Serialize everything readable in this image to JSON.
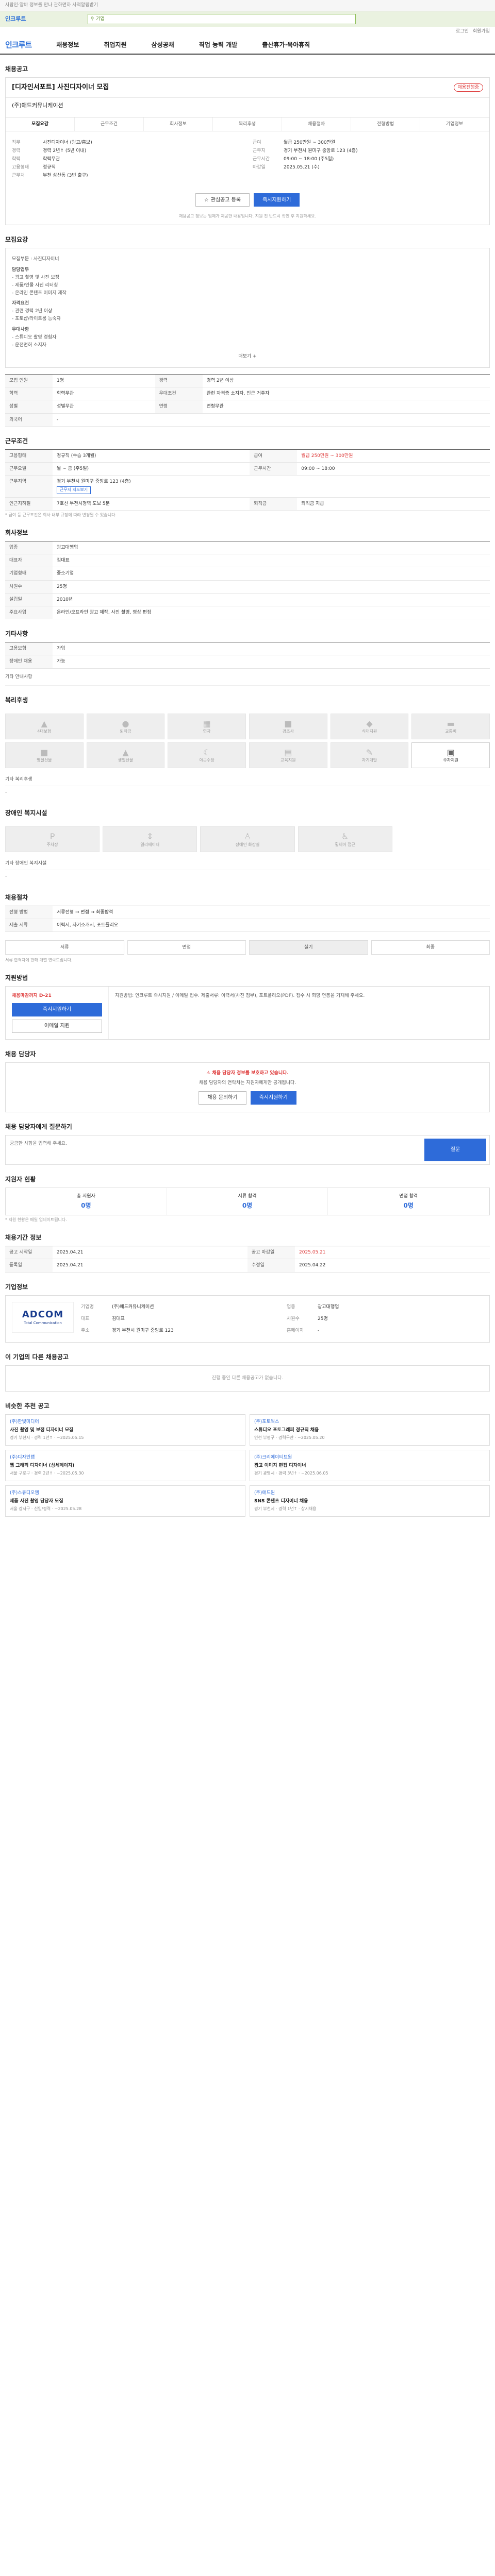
{
  "topbar": {
    "text": "사람인·알바 정보를 만나 관하면하 사적알림받기"
  },
  "search": {
    "brand": "인크루트",
    "placeholder": "기업"
  },
  "util": {
    "login": "로그인",
    "join": "회원가입"
  },
  "gnb": {
    "logo": "인크루트",
    "items": [
      "채용정보",
      "취업지원",
      "삼성공채",
      "직업 능력 개발",
      "출산휴가·육아휴직"
    ]
  },
  "job": {
    "section": "채용공고",
    "title": "[디자인서포트] 사진디자이너 모집",
    "badge": "채용진행중",
    "company": "(주)애드커뮤니케이션",
    "tabs": [
      "모집요강",
      "근무조건",
      "회사정보",
      "복리후생",
      "채용절차",
      "전형방법",
      "기업정보"
    ],
    "left": [
      {
        "k": "직무",
        "v": "사진디자이너 (광고/홍보)"
      },
      {
        "k": "경력",
        "v": "경력 2년↑ (5년 이내)"
      },
      {
        "k": "학력",
        "v": "학력무관"
      },
      {
        "k": "고용형태",
        "v": "정규직"
      },
      {
        "k": "근무처",
        "v": "부천 삼산동 (3번 출구)"
      }
    ],
    "right": [
      {
        "k": "급여",
        "v": "월급 250만원 ~ 300만원"
      },
      {
        "k": "근무지",
        "v": "경기 부천시 원미구 중앙로 123 (4층)"
      },
      {
        "k": "근무시간",
        "v": "09:00 ~ 18:00 (주5일)"
      },
      {
        "k": "마감일",
        "v": "2025.05.21 (수)"
      }
    ],
    "save": "관심공고 등록",
    "apply": "즉시지원하기",
    "note": "채용공고 정보는 업체가 제공한 내용입니다. 지원 전 반드시 확인 후 지원하세요."
  },
  "detail": {
    "title": "모집요강",
    "lines": [
      "모집부문 : 사진디자이너",
      "담당업무",
      "- 광고 촬영 및 사진 보정",
      "- 제품/인물 사진 리터칭",
      "- 온라인 콘텐츠 이미지 제작",
      "자격요건",
      "- 관련 경력 2년 이상",
      "- 포토샵/라이트룸 능숙자",
      "우대사항",
      "- 스튜디오 촬영 경험자",
      "- 운전면허 소지자"
    ],
    "more": "더보기 +"
  },
  "reqtable": [
    {
      "k": "모집 인원",
      "v": "1명"
    },
    {
      "k": "경력",
      "v": "경력 2년 이상"
    },
    {
      "k": "학력",
      "v": "학력무관"
    },
    {
      "k": "우대조건",
      "v": "관련 자격증 소지자, 인근 거주자"
    },
    {
      "k": "성별",
      "v": "성별무관"
    },
    {
      "k": "연령",
      "v": "연령무관"
    },
    {
      "k": "외국어",
      "v": "-"
    }
  ],
  "work": {
    "title": "근무조건",
    "rows": [
      {
        "k": "고용형태",
        "v": "정규직 (수습 3개월)"
      },
      {
        "k": "급여",
        "v": "월급 250만원 ~ 300만원"
      },
      {
        "k": "근무요일",
        "v": "월 ~ 금 (주5일)"
      },
      {
        "k": "근무시간",
        "v": "09:00 ~ 18:00"
      },
      {
        "k": "근무지역",
        "v": "경기 부천시 원미구 중앙로 123 (4층)"
      },
      {
        "k": "인근지하철",
        "v": "7호선 부천시청역 도보 5분"
      },
      {
        "k": "퇴직금",
        "v": "퇴직금 지급"
      }
    ],
    "tag": "근무지 지도보기",
    "note": "* 급여 등 근무조건은 회사 내부 규정에 따라 변경될 수 있습니다."
  },
  "company": {
    "title": "회사정보",
    "rows": [
      {
        "k": "업종",
        "v": "광고대행업"
      },
      {
        "k": "대표자",
        "v": "김대표"
      },
      {
        "k": "기업형태",
        "v": "중소기업"
      },
      {
        "k": "사원수",
        "v": "25명"
      },
      {
        "k": "설립일",
        "v": "2010년"
      },
      {
        "k": "주요사업",
        "v": "온라인/오프라인 광고 제작, 사진 촬영, 영상 편집"
      }
    ]
  },
  "apply_info": {
    "title": "기타사항",
    "rows": [
      {
        "k": "고용보험",
        "v": "가입"
      },
      {
        "k": "장애인 채용",
        "v": "가능"
      }
    ],
    "more": "기타 안내사항"
  },
  "welfare": {
    "title": "복리후생",
    "items": [
      "4대보험",
      "퇴직금",
      "연차",
      "경조사",
      "식대지원",
      "교통비",
      "명절선물",
      "생일선물",
      "야근수당",
      "교육지원",
      "자기개발",
      "주차지원"
    ],
    "on": [
      11
    ],
    "etc_label": "기타 복리후생",
    "etc": "-"
  },
  "disabled": {
    "title": "장애인 복지시설",
    "items": [
      "주차장",
      "엘리베이터",
      "장애인 화장실",
      "휠체어 접근"
    ],
    "etc_label": "기타 장애인 복지시설",
    "etc": "-"
  },
  "process": {
    "title": "채용절차",
    "rows": [
      {
        "k": "전형 방법",
        "v": "서류전형 → 면접 → 최종합격"
      },
      {
        "k": "제출 서류",
        "v": "이력서, 자기소개서, 포트폴리오"
      }
    ],
    "steps": [
      "서류",
      "면접",
      "실기",
      "최종"
    ],
    "step_on": 2,
    "note": "서류 합격자에 한해 개별 연락드립니다."
  },
  "applymethod": {
    "title": "지원방법",
    "status": "채용마감까지 D-21",
    "apply": "즉시지원하기",
    "email": "이메일 지원",
    "desc": "지원방법: 인크루트 즉시지원 / 이메일 접수. 제출서류: 이력서(사진 첨부), 포트폴리오(PDF). 접수 시 희망 연봉을 기재해 주세요."
  },
  "notice": {
    "title": "채용 담당자",
    "warn": "채용 담당자 정보를 보호하고 있습니다.",
    "desc": "채용 담당자의 연락처는 지원자에게만 공개됩니다.",
    "btn1": "채용 문의하기",
    "btn2": "즉시지원하기"
  },
  "qa": {
    "title": "채용 담당자에게 질문하기",
    "placeholder": "궁금한 사항을 입력해 주세요.",
    "send": "질문"
  },
  "stats": {
    "title": "지원자 현황",
    "items": [
      {
        "k": "총 지원자",
        "v": "0명"
      },
      {
        "k": "서류 합격",
        "v": "0명"
      },
      {
        "k": "면접 합격",
        "v": "0명"
      }
    ],
    "note": "* 지원 현황은 매일 업데이트됩니다."
  },
  "dates": {
    "title": "채용기간 정보",
    "rows": [
      {
        "k": "공고 시작일",
        "v": "2025.04.21"
      },
      {
        "k": "공고 마감일",
        "v": "2025.05.21"
      },
      {
        "k": "등록일",
        "v": "2025.04.21"
      },
      {
        "k": "수정일",
        "v": "2025.04.22"
      }
    ]
  },
  "corp": {
    "title": "기업정보",
    "logo": "ADCOM",
    "logo_sub": "Total Communication",
    "rows": [
      {
        "k": "기업명",
        "v": "(주)애드커뮤니케이션"
      },
      {
        "k": "업종",
        "v": "광고대행업"
      },
      {
        "k": "대표",
        "v": "김대표"
      },
      {
        "k": "사원수",
        "v": "25명"
      },
      {
        "k": "주소",
        "v": "경기 부천시 원미구 중앙로 123"
      },
      {
        "k": "홈페이지",
        "v": "-"
      }
    ]
  },
  "others": {
    "title": "이 기업의 다른 채용공고",
    "empty": "진행 중인 다른 채용공고가 없습니다."
  },
  "reco": {
    "title": "비슷한 추천 공고",
    "items": [
      {
        "co": "(주)한빛미디어",
        "title": "사진 촬영 및 보정 디자이너 모집",
        "meta": "경기 부천시 · 경력 1년↑ · ~2025.05.15"
      },
      {
        "co": "(주)포토웍스",
        "title": "스튜디오 포토그래퍼 정규직 채용",
        "meta": "인천 부평구 · 경력무관 · ~2025.05.20"
      },
      {
        "co": "(주)디자인랩",
        "title": "웹 그래픽 디자이너 (상세페이지)",
        "meta": "서울 구로구 · 경력 2년↑ · ~2025.05.30"
      },
      {
        "co": "(주)크리에이티브원",
        "title": "광고 이미지 편집 디자이너",
        "meta": "경기 광명시 · 경력 3년↑ · ~2025.06.05"
      },
      {
        "co": "(주)스튜디오엠",
        "title": "제품 사진 촬영 담당자 모집",
        "meta": "서울 강서구 · 신입/경력 · ~2025.05.28"
      },
      {
        "co": "(주)애드원",
        "title": "SNS 콘텐츠 디자이너 채용",
        "meta": "경기 부천시 · 경력 1년↑ · 상시채용"
      }
    ]
  }
}
